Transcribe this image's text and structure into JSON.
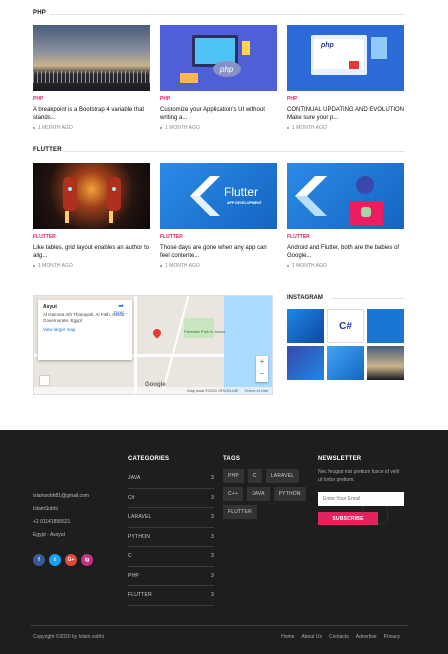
{
  "sections": [
    {
      "title": "PHP",
      "posts": [
        {
          "category": "PHP",
          "title": "A breakpoint is a Bootstrap 4 variable that stands...",
          "meta": "1 MONTH AGO",
          "thumb_alt": "sunset-city"
        },
        {
          "category": "PHP",
          "title": "Customize your Application's UI without writing a...",
          "meta": "1 MONTH AGO",
          "thumb_alt": "php-illustration"
        },
        {
          "category": "PHP",
          "title": "CONTINUAL UPDATING AND EVOLUTION Make sure your p...",
          "meta": "1 MONTH AGO",
          "thumb_alt": "php-monitor"
        }
      ]
    },
    {
      "title": "FLUTTER",
      "posts": [
        {
          "category": "FLUTTER",
          "title": "Like tables, grid layout enables an author to alig...",
          "meta": "1 MONTH AGO",
          "thumb_alt": "iron-man"
        },
        {
          "category": "FLUTTER",
          "title": "Those days are gone when any app can feel contente...",
          "meta": "1 MONTH AGO",
          "thumb_alt": "flutter-app-development"
        },
        {
          "category": "FLUTTER",
          "title": "Android and Flutter, both are the babies of Google...",
          "meta": "1 MONTH AGO",
          "thumb_alt": "flutter-android"
        }
      ]
    }
  ],
  "flutter_banner": {
    "word": "Flutter",
    "sub": "APP DEVELOPMENT"
  },
  "map": {
    "place": "Asyut",
    "address": "Al Hamrea Ath Thanayah, Al Fath, Assiut Governorate, Egypt",
    "larger_link": "View larger map",
    "directions": "Direc...",
    "park_label": "Paradise Park in Assiut",
    "logo": "Google",
    "attribution": "Map data ©2020 ORION-ME",
    "terms": "Terms of Use",
    "zoom_in": "+",
    "zoom_out": "−"
  },
  "instagram": {
    "title": "INSTAGRAM"
  },
  "footer": {
    "contact": {
      "email": "islamsobh81@gmail.com",
      "name": "IslamSobhi",
      "phone": "+2 01141856621",
      "location": "Egypt - Assyut"
    },
    "social": [
      "f",
      "t",
      "G+",
      "ig"
    ],
    "categories_title": "CATEGORIES",
    "categories": [
      {
        "name": "JAVA",
        "count": "3"
      },
      {
        "name": "C#",
        "count": "3"
      },
      {
        "name": "LARAVEL",
        "count": "3"
      },
      {
        "name": "PYTHON",
        "count": "3"
      },
      {
        "name": "C",
        "count": "3"
      },
      {
        "name": "PHP",
        "count": "3"
      },
      {
        "name": "FLUTTER",
        "count": "3"
      }
    ],
    "tags_title": "TAGS",
    "tags": [
      "PHP",
      "C",
      "LARAVEL",
      "C++",
      "JAVA",
      "PYTHON",
      "FLUTTER"
    ],
    "newsletter_title": "NEWSLETTER",
    "newsletter_text": "Nec feugiat nisl pretium fusce id velit ut tortor pretium.",
    "email_placeholder": "Enter Your Email",
    "subscribe": "SUBSCRIBE",
    "copyright": "Copyright ©2020 by Islam sobhi",
    "links": [
      "Home",
      "About Us",
      "Contacts",
      "Advertise",
      "Privacy"
    ]
  },
  "colors": {
    "accent": "#e0245e",
    "footer_bg": "#1e1e1f"
  }
}
